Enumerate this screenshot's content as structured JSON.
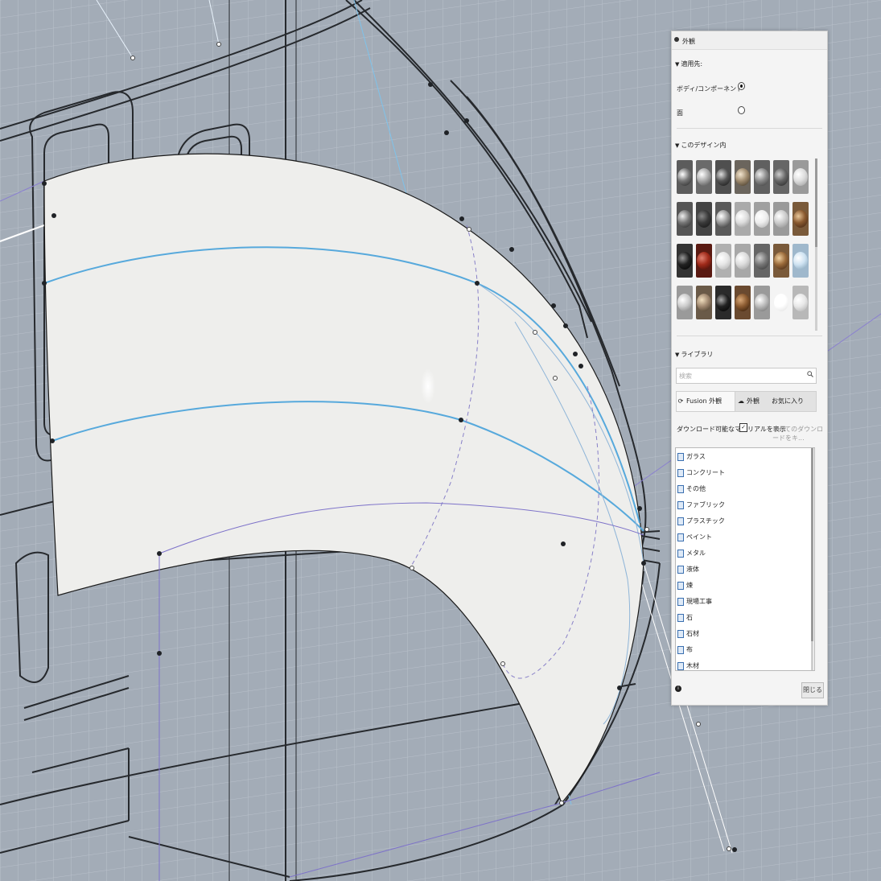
{
  "panel": {
    "title": "外観",
    "apply_to": {
      "heading": "適用先:",
      "options": [
        {
          "label": "ボディ/コンポーネント",
          "selected": true
        },
        {
          "label": "面",
          "selected": false
        }
      ]
    },
    "in_design": {
      "heading": "このデザイン内"
    },
    "library": {
      "heading": "ライブラリ",
      "search_placeholder": "検索",
      "tabs": [
        {
          "label": "Fusion 外観",
          "icon": "sync-icon"
        },
        {
          "label": "外観",
          "icon": "cloud-icon"
        },
        {
          "label": "お気に入り",
          "icon": ""
        }
      ],
      "download_label": "ダウンロード可能なマテリアルを表示",
      "download_checked": "✓",
      "download_all": "すべてのダウンロードをキ...",
      "items": [
        "ガラス",
        "コンクリート",
        "その他",
        "ファブリック",
        "プラスチック",
        "ペイント",
        "メタル",
        "液体",
        "煉",
        "現場工事",
        "石",
        "石材",
        "布",
        "木材"
      ]
    },
    "close_label": "閉じる",
    "info_label": "i"
  },
  "colors": {
    "surface": "#eeeeec",
    "spline": "#57a9dc",
    "sketch": "#26292d",
    "background": "#a3acb7"
  }
}
